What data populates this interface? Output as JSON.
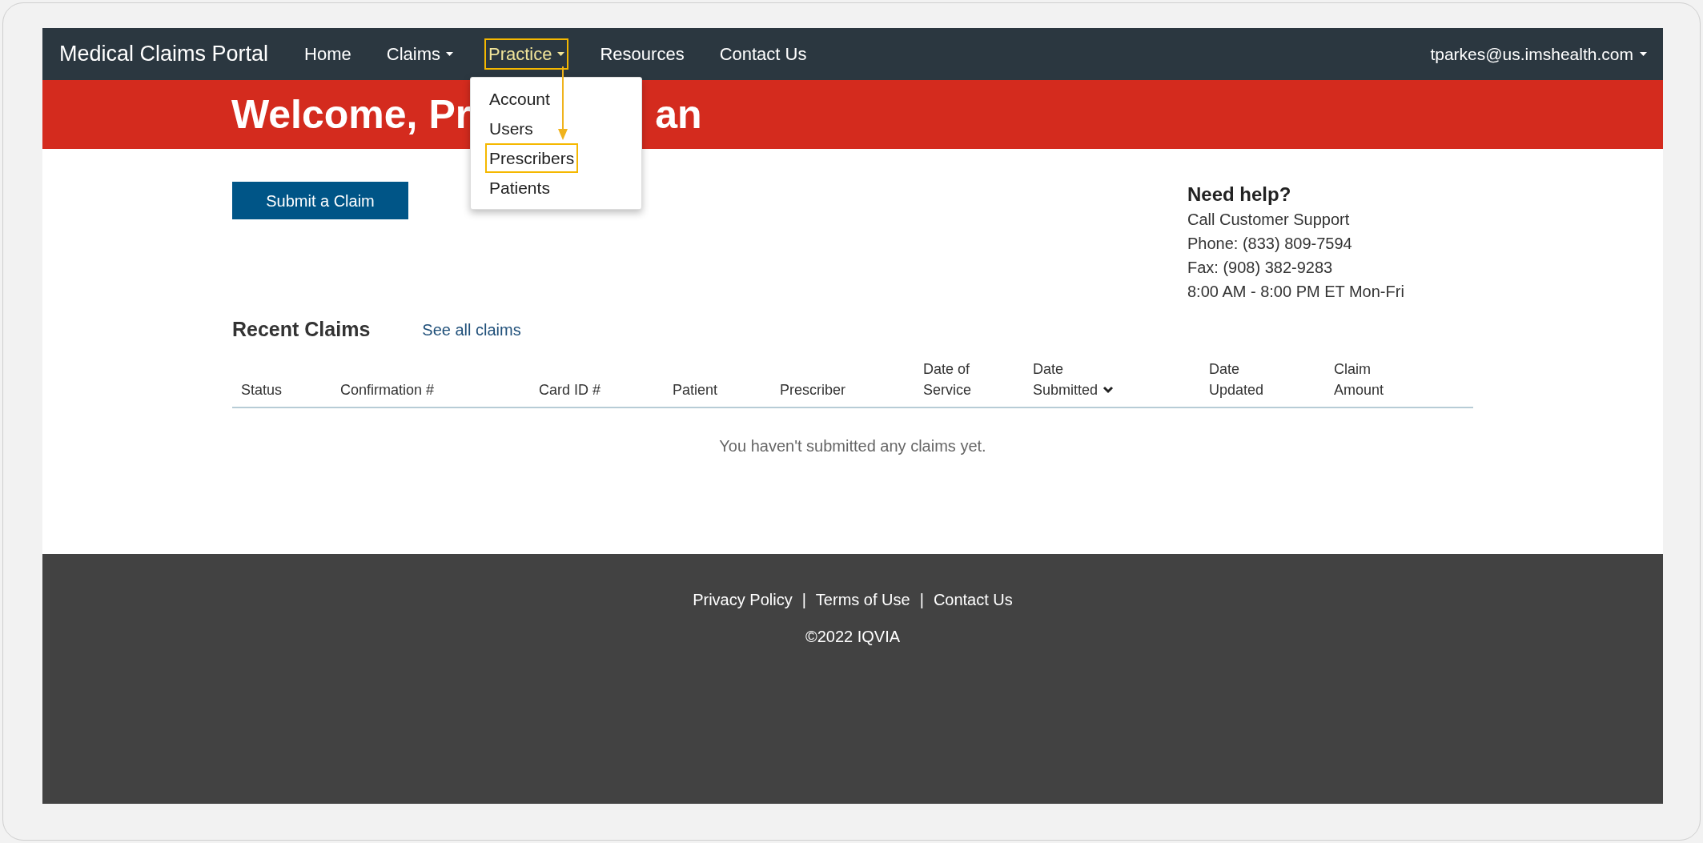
{
  "navbar": {
    "brand": "Medical Claims Portal",
    "items": [
      {
        "label": "Home",
        "dropdown": false,
        "highlighted": false
      },
      {
        "label": "Claims",
        "dropdown": true,
        "highlighted": false
      },
      {
        "label": "Practice",
        "dropdown": true,
        "highlighted": true
      },
      {
        "label": "Resources",
        "dropdown": false,
        "highlighted": false
      },
      {
        "label": "Contact Us",
        "dropdown": false,
        "highlighted": false
      }
    ],
    "user": "tparkes@us.imshealth.com"
  },
  "practice_menu": {
    "items": [
      {
        "label": "Account",
        "highlighted": false
      },
      {
        "label": "Users",
        "highlighted": false
      },
      {
        "label": "Prescribers",
        "highlighted": true
      },
      {
        "label": "Patients",
        "highlighted": false
      }
    ]
  },
  "banner": {
    "heading_parts": [
      "Welcome, Pr",
      "an"
    ]
  },
  "submit_button": "Submit a Claim",
  "help": {
    "title": "Need help?",
    "lines": [
      "Call Customer Support",
      "Phone: (833) 809-7594",
      "Fax: (908) 382-9283",
      "8:00 AM - 8:00 PM ET Mon-Fri"
    ]
  },
  "recent_claims": {
    "title": "Recent Claims",
    "link": "See all claims",
    "columns": [
      {
        "lines": [
          "Status"
        ],
        "sorted": false
      },
      {
        "lines": [
          "Confirmation #"
        ],
        "sorted": false
      },
      {
        "lines": [
          "Card ID #"
        ],
        "sorted": false
      },
      {
        "lines": [
          "Patient"
        ],
        "sorted": false
      },
      {
        "lines": [
          "Prescriber"
        ],
        "sorted": false
      },
      {
        "lines": [
          "Date of",
          "Service"
        ],
        "sorted": false
      },
      {
        "lines": [
          "Date",
          "Submitted"
        ],
        "sorted": true
      },
      {
        "lines": [
          "Date",
          "Updated"
        ],
        "sorted": false
      },
      {
        "lines": [
          "Claim",
          "Amount"
        ],
        "sorted": false
      }
    ],
    "empty_message": "You haven't submitted any claims yet."
  },
  "footer": {
    "links": [
      "Privacy Policy",
      "Terms of Use",
      "Contact Us"
    ],
    "separator": "|",
    "copyright": "©2022 IQVIA"
  }
}
